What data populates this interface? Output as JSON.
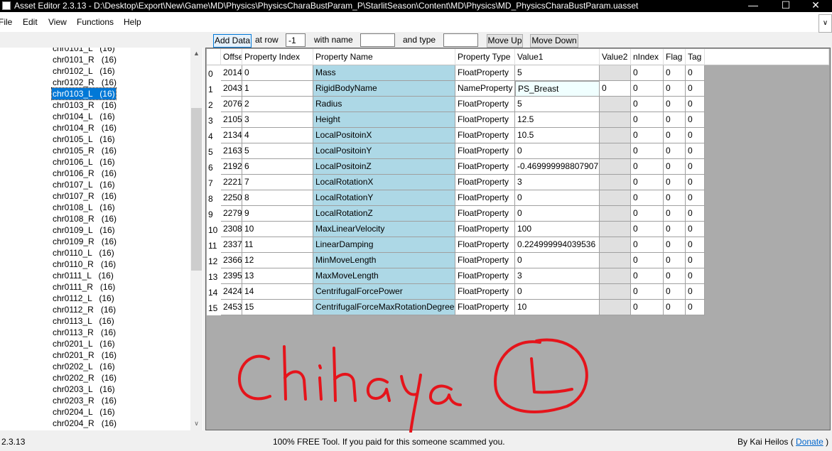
{
  "window": {
    "title": "Asset Editor 2.3.13 - D:\\Desktop\\Export\\New\\Game\\MD\\Physics\\PhysicsCharaBustParam_P\\StarlitSeason\\Content\\MD\\Physics\\MD_PhysicsCharaBustParam.uasset",
    "minimize_glyph": "—",
    "maximize_glyph": "☐",
    "close_glyph": "✕"
  },
  "menu": {
    "file": "File",
    "edit": "Edit",
    "view": "View",
    "functions": "Functions",
    "help": "Help",
    "combo_glyph": "∨"
  },
  "toolbar": {
    "add_data": "Add Data",
    "at_row_label": "at row",
    "row_value": "-1",
    "with_name_label": "with name",
    "name_value": "",
    "and_type_label": "and type",
    "type_value": "",
    "move_up": "Move Up",
    "move_down": "Move Down"
  },
  "tree": {
    "items": [
      {
        "label": "chr0101_L   (16)",
        "selected": false
      },
      {
        "label": "chr0101_R   (16)",
        "selected": false
      },
      {
        "label": "chr0102_L   (16)",
        "selected": false
      },
      {
        "label": "chr0102_R   (16)",
        "selected": false
      },
      {
        "label": "chr0103_L   (16)",
        "selected": true
      },
      {
        "label": "chr0103_R   (16)",
        "selected": false
      },
      {
        "label": "chr0104_L   (16)",
        "selected": false
      },
      {
        "label": "chr0104_R   (16)",
        "selected": false
      },
      {
        "label": "chr0105_L   (16)",
        "selected": false
      },
      {
        "label": "chr0105_R   (16)",
        "selected": false
      },
      {
        "label": "chr0106_L   (16)",
        "selected": false
      },
      {
        "label": "chr0106_R   (16)",
        "selected": false
      },
      {
        "label": "chr0107_L   (16)",
        "selected": false
      },
      {
        "label": "chr0107_R   (16)",
        "selected": false
      },
      {
        "label": "chr0108_L   (16)",
        "selected": false
      },
      {
        "label": "chr0108_R   (16)",
        "selected": false
      },
      {
        "label": "chr0109_L   (16)",
        "selected": false
      },
      {
        "label": "chr0109_R   (16)",
        "selected": false
      },
      {
        "label": "chr0110_L   (16)",
        "selected": false
      },
      {
        "label": "chr0110_R   (16)",
        "selected": false
      },
      {
        "label": "chr0111_L   (16)",
        "selected": false
      },
      {
        "label": "chr0111_R   (16)",
        "selected": false
      },
      {
        "label": "chr0112_L   (16)",
        "selected": false
      },
      {
        "label": "chr0112_R   (16)",
        "selected": false
      },
      {
        "label": "chr0113_L   (16)",
        "selected": false
      },
      {
        "label": "chr0113_R   (16)",
        "selected": false
      },
      {
        "label": "chr0201_L   (16)",
        "selected": false
      },
      {
        "label": "chr0201_R   (16)",
        "selected": false
      },
      {
        "label": "chr0202_L   (16)",
        "selected": false
      },
      {
        "label": "chr0202_R   (16)",
        "selected": false
      },
      {
        "label": "chr0203_L   (16)",
        "selected": false
      },
      {
        "label": "chr0203_R   (16)",
        "selected": false
      },
      {
        "label": "chr0204_L   (16)",
        "selected": false
      },
      {
        "label": "chr0204_R   (16)",
        "selected": false
      }
    ],
    "scroll_up_glyph": "▲",
    "scroll_down_glyph": "∨"
  },
  "grid": {
    "columns": [
      "Offset",
      "Property Index",
      "Property Name",
      "Property Type",
      "Value1",
      "Value2",
      "nIndex",
      "Flag",
      "Tag"
    ],
    "rows": [
      {
        "num": "0",
        "cells": [
          "2014",
          "0",
          "Mass",
          "FloatProperty",
          "5",
          "",
          "0",
          "0",
          "0"
        ]
      },
      {
        "num": "1",
        "cells": [
          "2043",
          "1",
          "RigidBodyName",
          "NameProperty",
          "PS_Breast",
          "0",
          "0",
          "0",
          "0"
        ]
      },
      {
        "num": "2",
        "cells": [
          "2076",
          "2",
          "Radius",
          "FloatProperty",
          "5",
          "",
          "0",
          "0",
          "0"
        ]
      },
      {
        "num": "3",
        "cells": [
          "2105",
          "3",
          "Height",
          "FloatProperty",
          "12.5",
          "",
          "0",
          "0",
          "0"
        ]
      },
      {
        "num": "4",
        "cells": [
          "2134",
          "4",
          "LocalPositoinX",
          "FloatProperty",
          "10.5",
          "",
          "0",
          "0",
          "0"
        ]
      },
      {
        "num": "5",
        "cells": [
          "2163",
          "5",
          "LocalPositoinY",
          "FloatProperty",
          "0",
          "",
          "0",
          "0",
          "0"
        ]
      },
      {
        "num": "6",
        "cells": [
          "2192",
          "6",
          "LocalPositoinZ",
          "FloatProperty",
          "-0.469999998807907",
          "",
          "0",
          "0",
          "0"
        ]
      },
      {
        "num": "7",
        "cells": [
          "2221",
          "7",
          "LocalRotationX",
          "FloatProperty",
          "3",
          "",
          "0",
          "0",
          "0"
        ]
      },
      {
        "num": "8",
        "cells": [
          "2250",
          "8",
          "LocalRotationY",
          "FloatProperty",
          "0",
          "",
          "0",
          "0",
          "0"
        ]
      },
      {
        "num": "9",
        "cells": [
          "2279",
          "9",
          "LocalRotationZ",
          "FloatProperty",
          "0",
          "",
          "0",
          "0",
          "0"
        ]
      },
      {
        "num": "10",
        "cells": [
          "2308",
          "10",
          "MaxLinearVelocity",
          "FloatProperty",
          "100",
          "",
          "0",
          "0",
          "0"
        ]
      },
      {
        "num": "11",
        "cells": [
          "2337",
          "11",
          "LinearDamping",
          "FloatProperty",
          "0.224999994039536",
          "",
          "0",
          "0",
          "0"
        ]
      },
      {
        "num": "12",
        "cells": [
          "2366",
          "12",
          "MinMoveLength",
          "FloatProperty",
          "0",
          "",
          "0",
          "0",
          "0"
        ]
      },
      {
        "num": "13",
        "cells": [
          "2395",
          "13",
          "MaxMoveLength",
          "FloatProperty",
          "3",
          "",
          "0",
          "0",
          "0"
        ]
      },
      {
        "num": "14",
        "cells": [
          "2424",
          "14",
          "CentrifugalForcePower",
          "FloatProperty",
          "0",
          "",
          "0",
          "0",
          "0"
        ]
      },
      {
        "num": "15",
        "cells": [
          "2453",
          "15",
          "CentrifugalForceMaxRotationDegree",
          "FloatProperty",
          "10",
          "",
          "0",
          "0",
          "0"
        ]
      }
    ]
  },
  "status": {
    "version": "2.3.13",
    "message": "100% FREE Tool. If you paid for this someone scammed you.",
    "credit": "By Kai Heilos (",
    "donate": "Donate",
    "credit_end": ")"
  },
  "annotation": {
    "handwriting": "Chihaya",
    "color": "#e5141b"
  },
  "colors": {
    "selection": "#0078d7",
    "name_cell": "#add8e6",
    "grid_bg": "#ababab"
  }
}
